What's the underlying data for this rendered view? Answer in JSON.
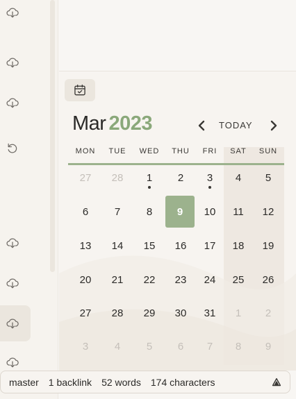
{
  "calendar": {
    "month": "Mar",
    "year": "2023",
    "today_label": "TODAY",
    "weekdays": [
      "MON",
      "TUE",
      "WED",
      "THU",
      "FRI",
      "SAT",
      "SUN"
    ],
    "weeks": [
      [
        {
          "d": "27",
          "m": true
        },
        {
          "d": "28",
          "m": true
        },
        {
          "d": "1",
          "dot": true
        },
        {
          "d": "2"
        },
        {
          "d": "3",
          "dot": true
        },
        {
          "d": "4"
        },
        {
          "d": "5"
        }
      ],
      [
        {
          "d": "6"
        },
        {
          "d": "7"
        },
        {
          "d": "8"
        },
        {
          "d": "9",
          "today": true
        },
        {
          "d": "10"
        },
        {
          "d": "11"
        },
        {
          "d": "12"
        }
      ],
      [
        {
          "d": "13"
        },
        {
          "d": "14"
        },
        {
          "d": "15"
        },
        {
          "d": "16"
        },
        {
          "d": "17"
        },
        {
          "d": "18"
        },
        {
          "d": "19"
        }
      ],
      [
        {
          "d": "20"
        },
        {
          "d": "21"
        },
        {
          "d": "22"
        },
        {
          "d": "23"
        },
        {
          "d": "24"
        },
        {
          "d": "25"
        },
        {
          "d": "26"
        }
      ],
      [
        {
          "d": "27"
        },
        {
          "d": "28"
        },
        {
          "d": "29"
        },
        {
          "d": "30"
        },
        {
          "d": "31"
        },
        {
          "d": "1",
          "m": true
        },
        {
          "d": "2",
          "m": true
        }
      ],
      [
        {
          "d": "3",
          "m": true
        },
        {
          "d": "4",
          "m": true
        },
        {
          "d": "5",
          "m": true
        },
        {
          "d": "6",
          "m": true
        },
        {
          "d": "7",
          "m": true
        },
        {
          "d": "8",
          "m": true
        },
        {
          "d": "9",
          "m": true
        }
      ]
    ],
    "accent_color": "#9cb28d"
  },
  "rail": {
    "icons": [
      "cloud-download-icon",
      "cloud-download-icon",
      "cloud-download-icon",
      "undo-icon",
      "cloud-download-icon",
      "cloud-download-icon",
      "cloud-download-icon",
      "cloud-download-icon"
    ]
  },
  "status_bar": {
    "branch": "master",
    "backlinks": "1 backlink",
    "words": "52 words",
    "characters": "174 characters",
    "sync_icon": "sync-icon"
  }
}
